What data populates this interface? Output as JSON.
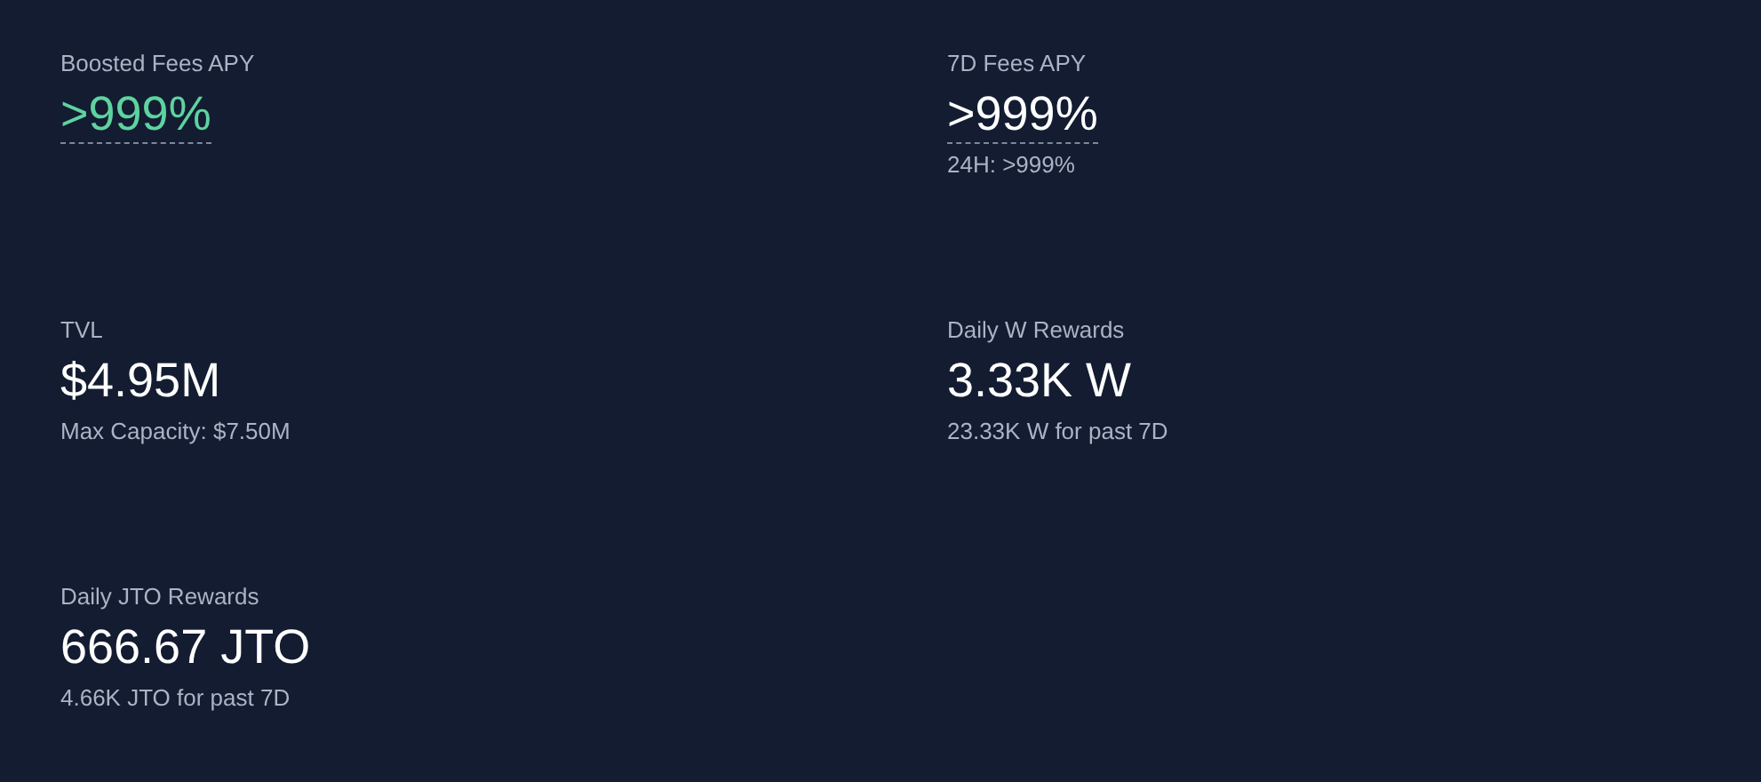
{
  "stats": [
    {
      "label": "Boosted Fees APY",
      "value": ">999%",
      "highlighted": true,
      "dashed_underline": true
    },
    {
      "label": "7D Fees APY",
      "value": ">999%",
      "highlighted": false,
      "dashed_underline": true,
      "sub": "24H: >999%"
    },
    {
      "label": "TVL",
      "value": "$4.95M",
      "highlighted": false,
      "dashed_underline": false,
      "sub": "Max Capacity: $7.50M"
    },
    {
      "label": "Daily W Rewards",
      "value": "3.33K W",
      "highlighted": false,
      "dashed_underline": false,
      "sub": "23.33K W for past 7D"
    },
    {
      "label": "Daily JTO Rewards",
      "value": "666.67 JTO",
      "highlighted": false,
      "dashed_underline": false,
      "sub": "4.66K JTO for past 7D"
    }
  ]
}
